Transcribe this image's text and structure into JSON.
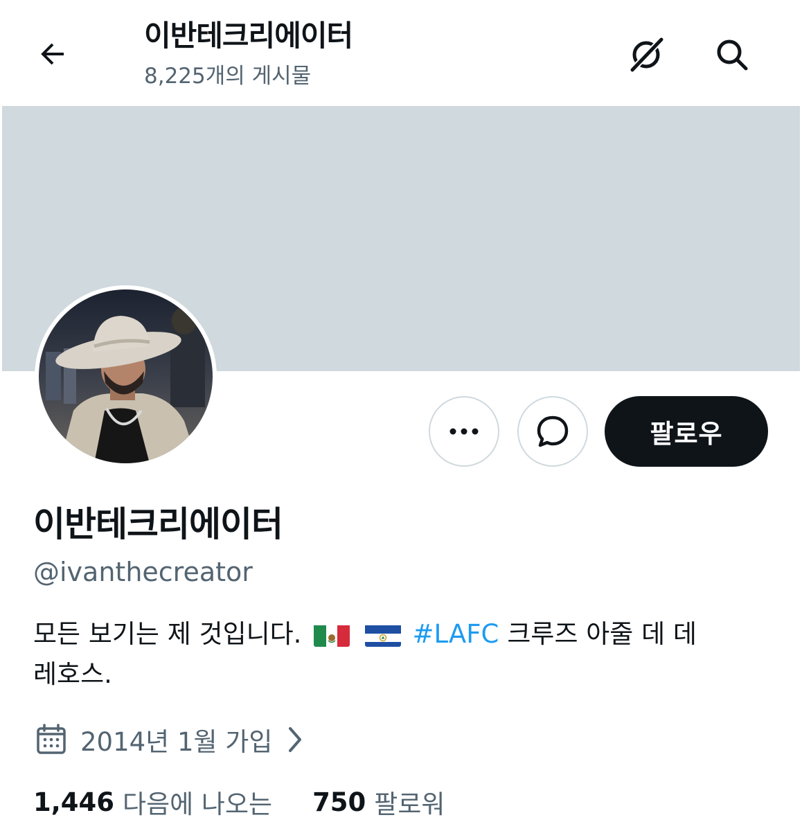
{
  "header": {
    "title": "이반테크리에이터",
    "post_count": "8,225개의 게시물"
  },
  "icons": {
    "back": "arrow-left-icon",
    "grok": "grok-icon",
    "search": "search-icon",
    "more": "more-dots-icon",
    "message": "message-bubble-icon",
    "calendar": "calendar-icon",
    "chevron": "chevron-right-icon"
  },
  "profile": {
    "display_name": "이반테크리에이터",
    "handle": "@ivanthecreator",
    "bio_part1": "모든 보기는 제 것입니다.",
    "bio_hashtag": "#LAFC",
    "bio_part2": "크루즈 아줄 데 데",
    "bio_line2": "레호스.",
    "flags": [
      "mexico-flag",
      "el-salvador-flag"
    ],
    "joined": "2014년 1월 가입"
  },
  "actions": {
    "follow_label": "팔로우"
  },
  "stats": {
    "following_count": "1,446",
    "following_label": "다음에 나오는",
    "followers_count": "750",
    "followers_label": "팔로워"
  },
  "colors": {
    "banner": "#cfd9de",
    "text": "#0f1419",
    "secondary": "#536471",
    "link": "#1d9bf0",
    "follow_button": "#0f1419"
  }
}
